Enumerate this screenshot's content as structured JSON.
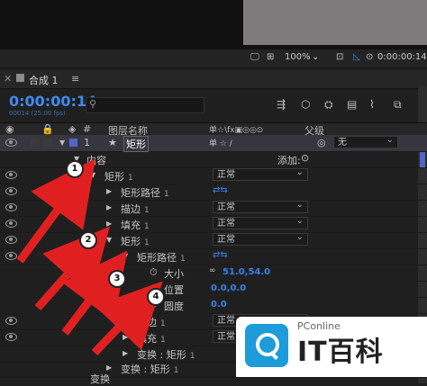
{
  "viewer": {
    "zoom": "100%",
    "timecode": "0:00:00:14"
  },
  "panel": {
    "title": "合成 1",
    "menu": "≡"
  },
  "timeline": {
    "timecode": "0:00:00:14",
    "fps": "00014 (25.00 fps)"
  },
  "columns": {
    "num": "#",
    "layer_name": "图层名称",
    "switches": "单☆\\fx▣◎◎⊙",
    "parent": "父级"
  },
  "rows": [
    {
      "label": "矩形",
      "num": "1",
      "parent": "无"
    },
    {
      "label": "内容",
      "add": "添加:"
    },
    {
      "label": "矩形",
      "num": "1",
      "mode": "正常"
    },
    {
      "label": "矩形路径",
      "num": "1"
    },
    {
      "label": "描边",
      "num": "1",
      "mode": "正常"
    },
    {
      "label": "填充",
      "num": "1",
      "mode": "正常"
    },
    {
      "label": "矩形",
      "num": "1",
      "mode": "正常"
    },
    {
      "label": "矩形路径",
      "num": "1"
    },
    {
      "label": "大小",
      "value": "51.0,54.0"
    },
    {
      "label": "位置",
      "value": "0.0,0.0"
    },
    {
      "label": "圆度",
      "value": "0.0"
    },
    {
      "label": "描边",
      "num": "1",
      "mode": "正常"
    },
    {
      "label": "填充",
      "num": "1",
      "mode": "正常"
    },
    {
      "label": "变换 : 矩形",
      "num": "1"
    },
    {
      "label": "变换 : 矩形",
      "num": "1"
    },
    {
      "label": "变换"
    }
  ],
  "badges": [
    "1",
    "2",
    "3",
    "4"
  ],
  "watermark": {
    "small": "PConline",
    "big": "IT百科"
  },
  "colors": {
    "accent": "#3d8bf0",
    "arrow": "#e02020"
  }
}
